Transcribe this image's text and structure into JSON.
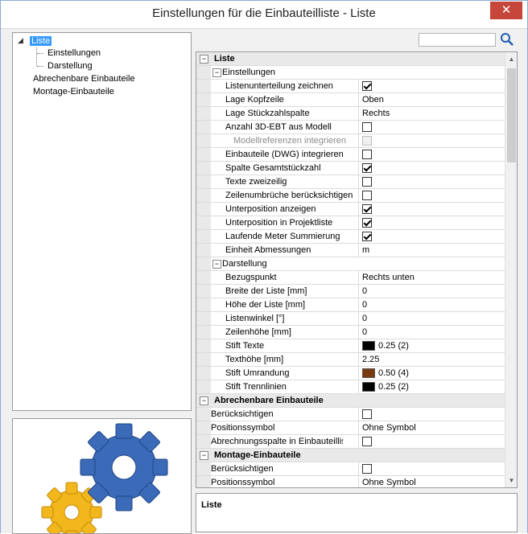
{
  "window": {
    "title": "Einstellungen für die Einbauteilliste - Liste",
    "close_glyph": "✕"
  },
  "tree": {
    "items": [
      {
        "label": "Liste"
      },
      {
        "label": "Einstellungen"
      },
      {
        "label": "Darstellung"
      },
      {
        "label": "Abrechenbare Einbauteile"
      },
      {
        "label": "Montage-Einbauteile"
      }
    ]
  },
  "search": {
    "placeholder": "",
    "value": ""
  },
  "grid": {
    "root": "Liste",
    "groups": {
      "einstellungen": "Einstellungen",
      "darstellung": "Darstellung",
      "abrechenbare": "Abrechenbare Einbauteile",
      "montage": "Montage-Einbauteile"
    },
    "einstellungen_rows": [
      {
        "label": "Listenunterteilung zeichnen",
        "type": "check",
        "checked": true
      },
      {
        "label": "Lage Kopfzeile",
        "type": "text",
        "value": "Oben"
      },
      {
        "label": "Lage Stückzahlspalte",
        "type": "text",
        "value": "Rechts"
      },
      {
        "label": "Anzahl 3D-EBT aus Modell",
        "type": "check",
        "checked": false
      },
      {
        "label": "Modellreferenzen integrieren",
        "type": "check",
        "checked": false,
        "disabled": true
      },
      {
        "label": "Einbauteile (DWG) integrieren",
        "type": "check",
        "checked": false
      },
      {
        "label": "Spalte Gesamtstückzahl",
        "type": "check",
        "checked": true
      },
      {
        "label": "Texte zweizeilig",
        "type": "check",
        "checked": false
      },
      {
        "label": "Zeilenumbrüche berücksichtigen",
        "type": "check",
        "checked": false
      },
      {
        "label": "Unterposition anzeigen",
        "type": "check",
        "checked": true
      },
      {
        "label": "Unterposition in Projektliste",
        "type": "check",
        "checked": true
      },
      {
        "label": "Laufende Meter Summierung",
        "type": "check",
        "checked": true
      },
      {
        "label": "Einheit Abmessungen",
        "type": "text",
        "value": "m"
      }
    ],
    "darstellung_rows": [
      {
        "label": "Bezugspunkt",
        "type": "text",
        "value": "Rechts unten"
      },
      {
        "label": "Breite der Liste [mm]",
        "type": "text",
        "value": "0"
      },
      {
        "label": "Höhe der Liste [mm]",
        "type": "text",
        "value": "0"
      },
      {
        "label": "Listenwinkel [°]",
        "type": "text",
        "value": "0"
      },
      {
        "label": "Zeilenhöhe [mm]",
        "type": "text",
        "value": "0"
      },
      {
        "label": "Stift Texte",
        "type": "pen",
        "value": "0.25 (2)",
        "color": "#000000"
      },
      {
        "label": "Texthöhe [mm]",
        "type": "text",
        "value": "2.25"
      },
      {
        "label": "Stift Umrandung",
        "type": "pen",
        "value": "0.50 (4)",
        "color": "#7a3a10"
      },
      {
        "label": "Stift Trennlinien",
        "type": "pen",
        "value": "0.25 (2)",
        "color": "#000000"
      }
    ],
    "abrechenbare_rows": [
      {
        "label": "Berücksichtigen",
        "type": "check",
        "checked": false
      },
      {
        "label": "Positionssymbol",
        "type": "text",
        "value": "Ohne Symbol"
      },
      {
        "label": "Abrechnungsspalte in Einbauteilliste",
        "type": "check",
        "checked": false
      }
    ],
    "montage_rows": [
      {
        "label": "Berücksichtigen",
        "type": "check",
        "checked": false
      },
      {
        "label": "Positionssymbol",
        "type": "text",
        "value": "Ohne Symbol"
      }
    ]
  },
  "description": {
    "title": "Liste"
  }
}
